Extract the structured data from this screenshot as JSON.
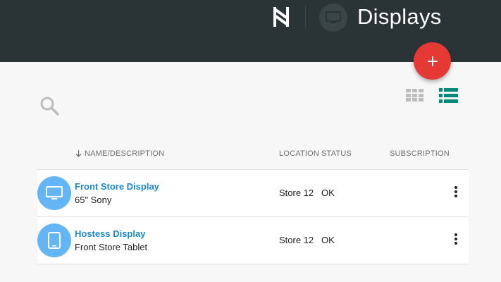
{
  "header": {
    "title": "Displays",
    "logo_icon": "brand-logo-icon",
    "section_icon": "monitor-icon",
    "colors": {
      "bar": "#2a3336",
      "fab": "#e53935"
    }
  },
  "fab": {
    "icon": "plus-icon"
  },
  "toolbar": {
    "search_icon": "search-icon",
    "views": [
      "grid-view-icon",
      "list-view-icon"
    ],
    "active_view": "list"
  },
  "table": {
    "sort_icon": "arrow-down-icon",
    "columns": {
      "name": "NAME/DESCRIPTION",
      "location": "LOCATION",
      "status": "STATUS",
      "subscription": "SUBSCRIPTION"
    },
    "rows": [
      {
        "name": "Front Store Display",
        "description": "65\" Sony",
        "location": "Store 12",
        "status": "OK",
        "icon": "monitor-icon"
      },
      {
        "name": "Hostess Display",
        "description": "Front Store Tablet",
        "location": "Store 12",
        "status": "OK",
        "icon": "tablet-icon"
      }
    ]
  }
}
